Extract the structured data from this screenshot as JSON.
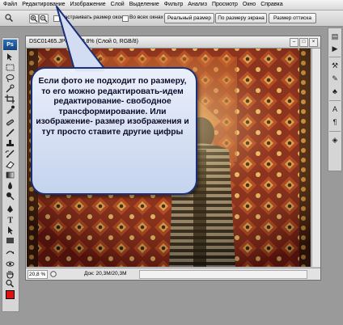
{
  "menu": [
    "Файл",
    "Редактирование",
    "Изображение",
    "Слой",
    "Выделение",
    "Фильтр",
    "Анализ",
    "Просмотр",
    "Окно",
    "Справка"
  ],
  "options": {
    "resize_windows_label": "Настраивать размер окон",
    "all_windows_label": "Во всех окнах",
    "actual_pixels": "Реальный размер",
    "fit_screen": "По размеру экрана",
    "print_size": "Размер оттиска"
  },
  "toolbox": {
    "logo": "Ps",
    "tools": [
      "move-tool",
      "marquee-tool",
      "lasso-tool",
      "quick-selection-tool",
      "crop-tool",
      "eyedropper-tool",
      "healing-brush-tool",
      "brush-tool",
      "clone-stamp-tool",
      "history-brush-tool",
      "eraser-tool",
      "gradient-tool",
      "blur-tool",
      "dodge-tool",
      "pen-tool",
      "type-tool",
      "path-selection-tool",
      "shape-tool",
      "3d-rotate-tool",
      "3d-orbit-tool",
      "hand-tool",
      "zoom-tool"
    ],
    "foreground_color": "#e01010",
    "background_color": "#ffffff"
  },
  "document": {
    "title": "DSC01465.JPG @ 20,8% (Слой 0, RGB/8)",
    "zoom": "20,8 %",
    "doc_info": "Док: 20,3M/20,3M"
  },
  "right_panel": [
    "history-icon",
    "actions-icon",
    "tools-preset-icon",
    "brushes-icon",
    "clone-source-icon",
    "character-icon",
    "paragraph-icon",
    "layers-icon"
  ],
  "callout": {
    "text": "Если фото не подходит по размеру, то его можно редактировать-идем редактирование- свободное трансформирование. Или изображение- размер изображения и тут просто ставите другие цифры"
  }
}
